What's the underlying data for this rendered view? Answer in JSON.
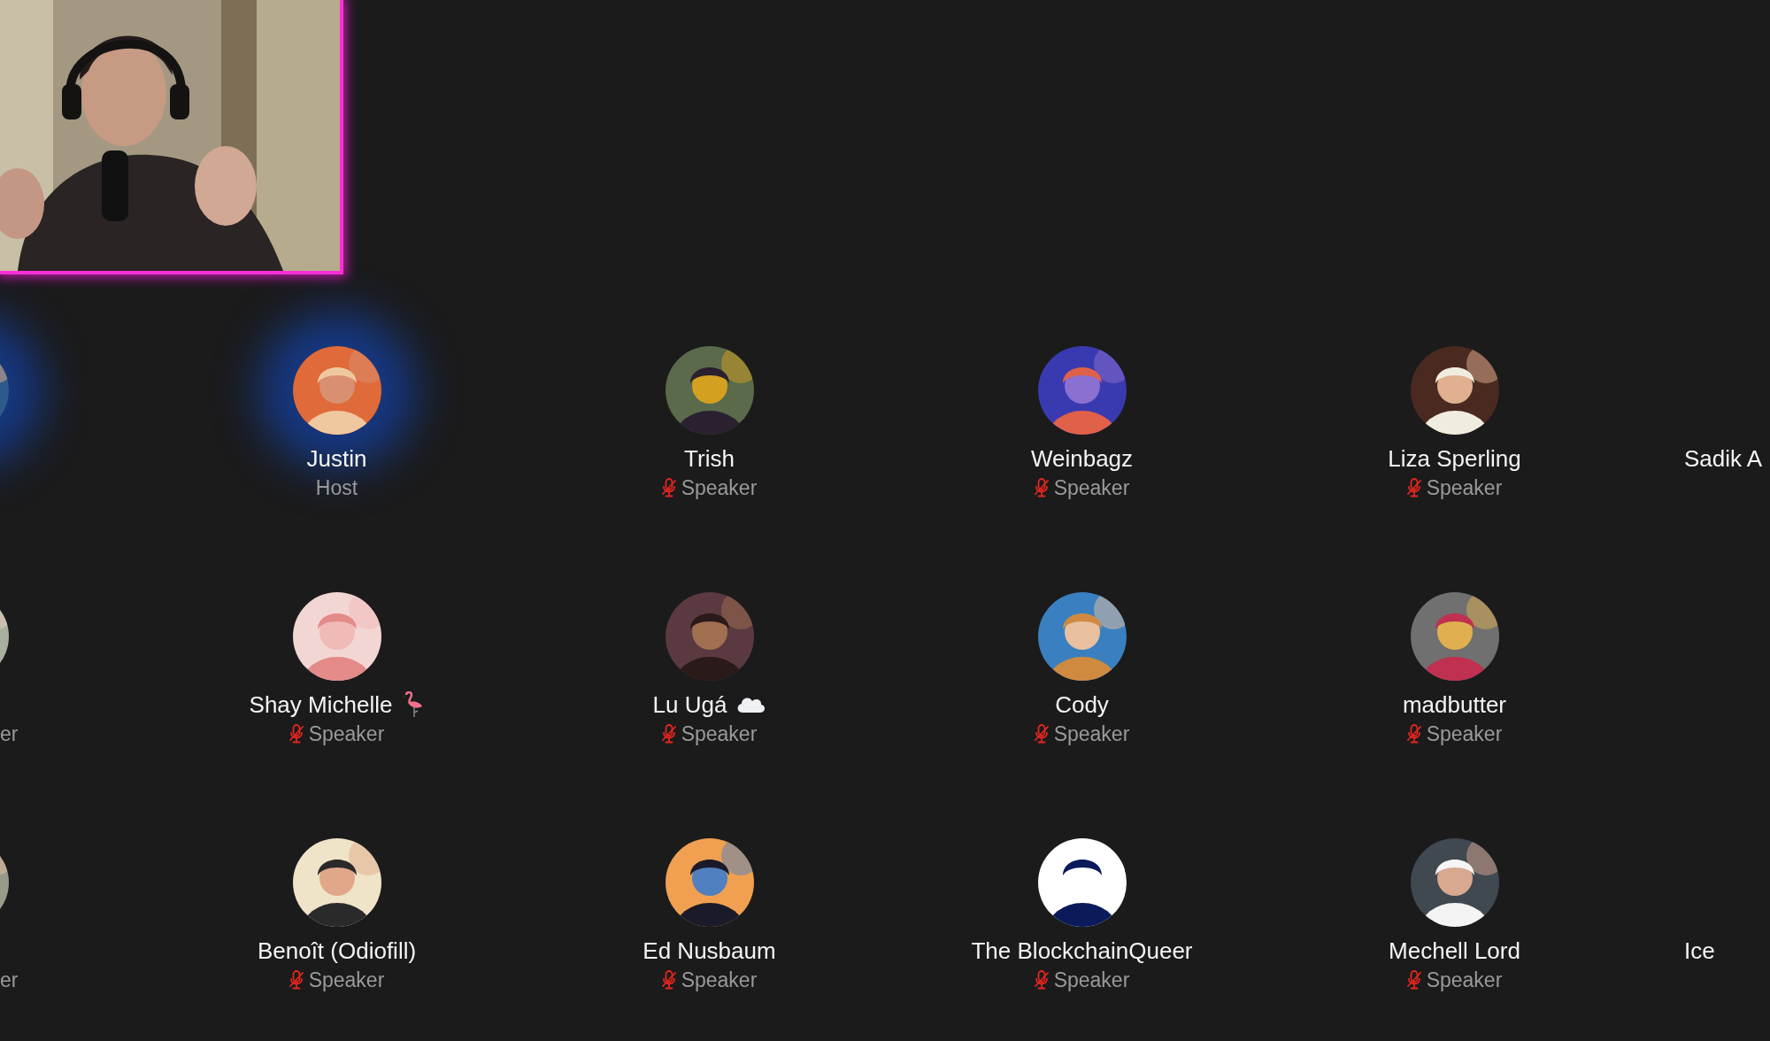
{
  "rows": [
    {
      "tiles": [
        {
          "kind": "cut-left",
          "speaking": true
        },
        {
          "name": "Justin",
          "role": "Host",
          "speaking": true,
          "muted": false
        },
        {
          "name": "Trish",
          "role": "Speaker",
          "speaking": false,
          "muted": true
        },
        {
          "name": "Weinbagz",
          "role": "Speaker",
          "speaking": false,
          "muted": true
        },
        {
          "name": "Liza Sperling",
          "role": "Speaker",
          "speaking": false,
          "muted": true
        },
        {
          "kind": "cut-right",
          "name": "Sadik A"
        }
      ]
    },
    {
      "tiles": [
        {
          "kind": "cut-left",
          "role": "er",
          "speaking": false
        },
        {
          "name": "Shay Michelle",
          "badge": {
            "kind": "flamingo"
          },
          "role": "Speaker",
          "speaking": false,
          "muted": true
        },
        {
          "name": "Lu Ugá",
          "badge": {
            "kind": "cloud"
          },
          "role": "Speaker",
          "speaking": false,
          "muted": true
        },
        {
          "name": "Cody",
          "role": "Speaker",
          "speaking": false,
          "muted": true
        },
        {
          "name": "madbutter",
          "role": "Speaker",
          "speaking": false,
          "muted": true
        }
      ]
    },
    {
      "tiles": [
        {
          "kind": "cut-left",
          "role": "er",
          "speaking": false
        },
        {
          "name": "Benoît (Odiofill)",
          "role": "Speaker",
          "speaking": false,
          "muted": true
        },
        {
          "name": "Ed Nusbaum",
          "role": "Speaker",
          "speaking": false,
          "muted": true
        },
        {
          "name": "The BlockchainQueer",
          "role": "Speaker",
          "speaking": false,
          "muted": true
        },
        {
          "name": "Mechell Lord",
          "role": "Speaker",
          "speaking": false,
          "muted": true
        },
        {
          "kind": "cut-right",
          "name": "Ice"
        }
      ]
    }
  ]
}
